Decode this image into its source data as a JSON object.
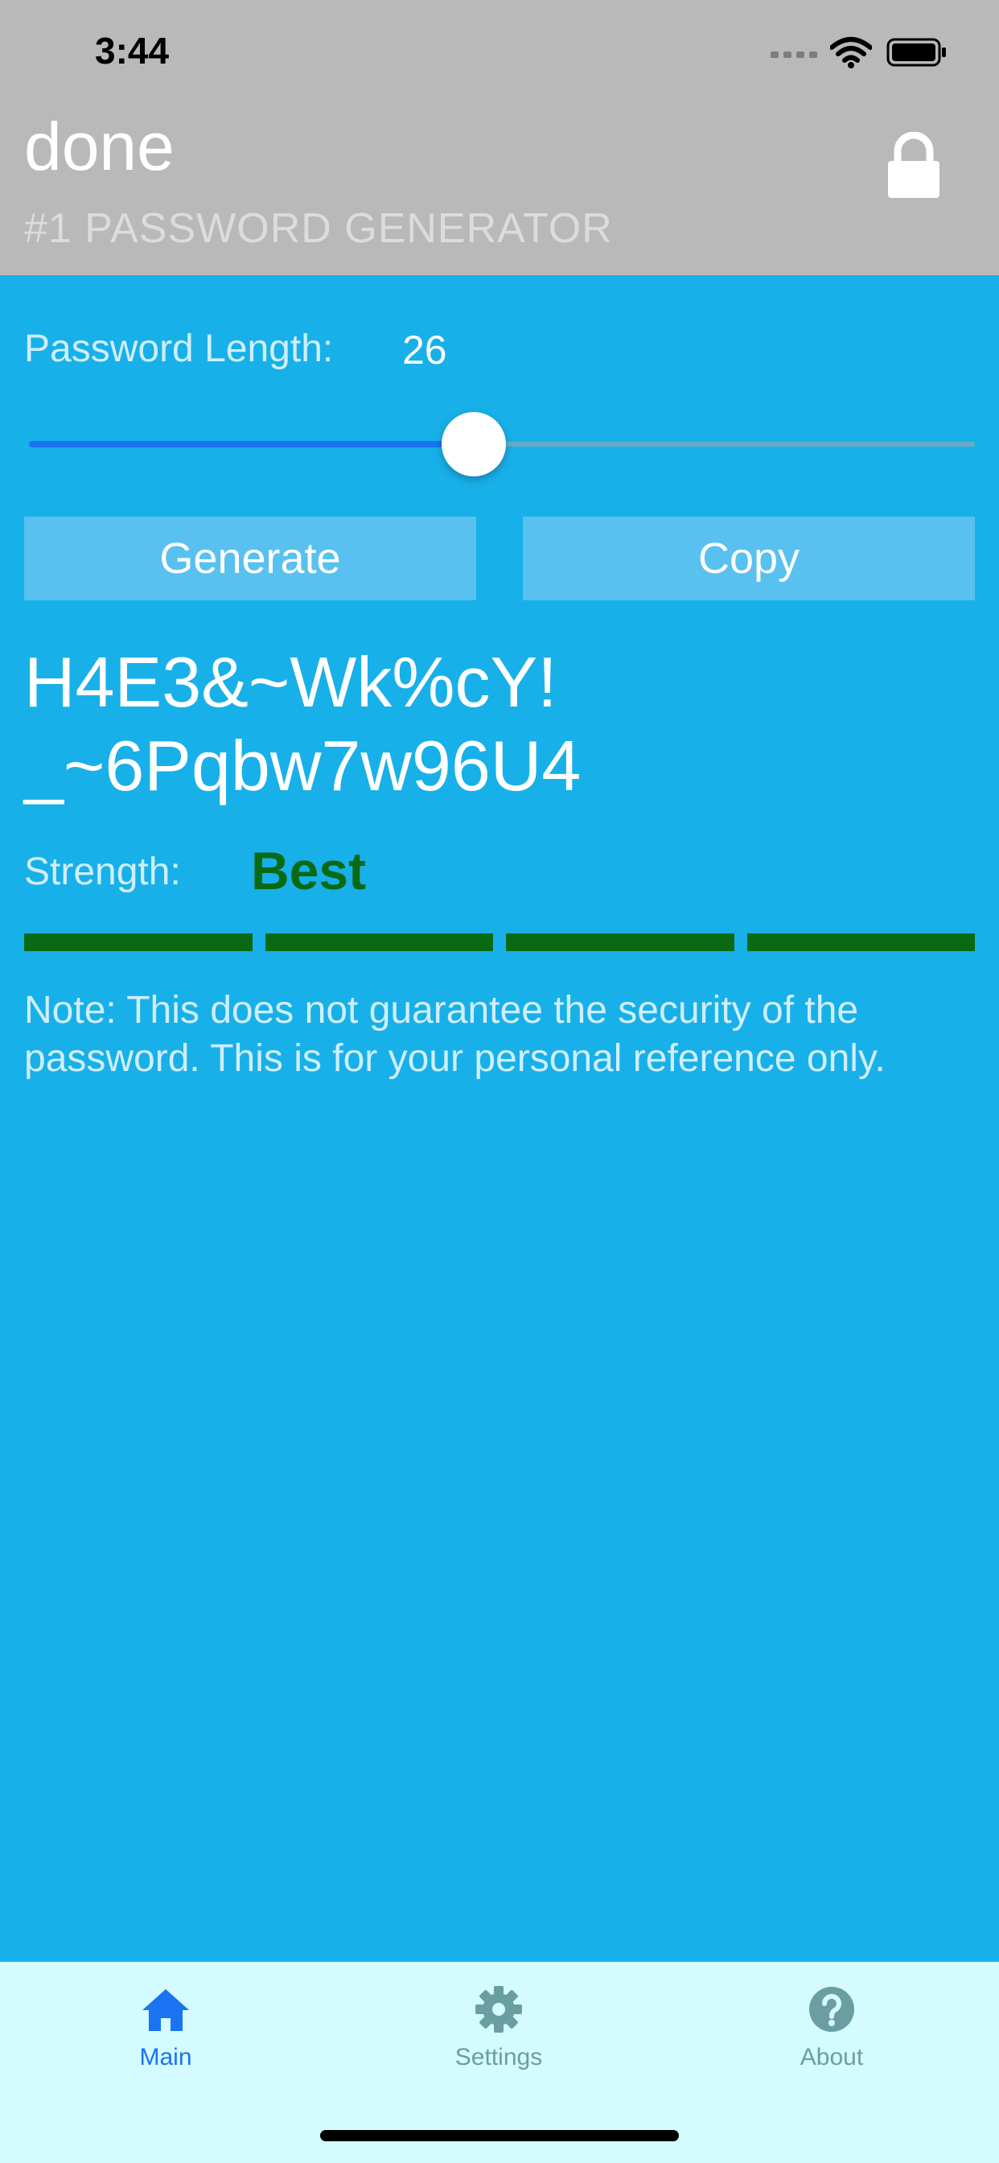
{
  "status_bar": {
    "time": "3:44"
  },
  "header": {
    "title": "done",
    "subtitle": "#1 PASSWORD GENERATOR"
  },
  "length": {
    "label": "Password Length:",
    "value": "26",
    "slider_fraction": 0.47
  },
  "buttons": {
    "generate_label": "Generate",
    "copy_label": "Copy"
  },
  "password": {
    "line1": "H4E3&~Wk%cY!",
    "line2": "_~6Pqbw7w96U4"
  },
  "strength": {
    "label": "Strength:",
    "value": "Best",
    "bars_filled": 4,
    "bars_total": 4,
    "color": "#0a6a14"
  },
  "note": "Note: This does not guarantee the security of the password. This is for your personal reference only.",
  "tabs": [
    {
      "label": "Main",
      "icon": "home-icon",
      "active": true
    },
    {
      "label": "Settings",
      "icon": "gear-icon",
      "active": false
    },
    {
      "label": "About",
      "icon": "help-icon",
      "active": false
    }
  ],
  "colors": {
    "background": "#18b0e8",
    "header": "#b9b9b9",
    "accent": "#1a73f0",
    "tabbar": "#d4fbff"
  }
}
